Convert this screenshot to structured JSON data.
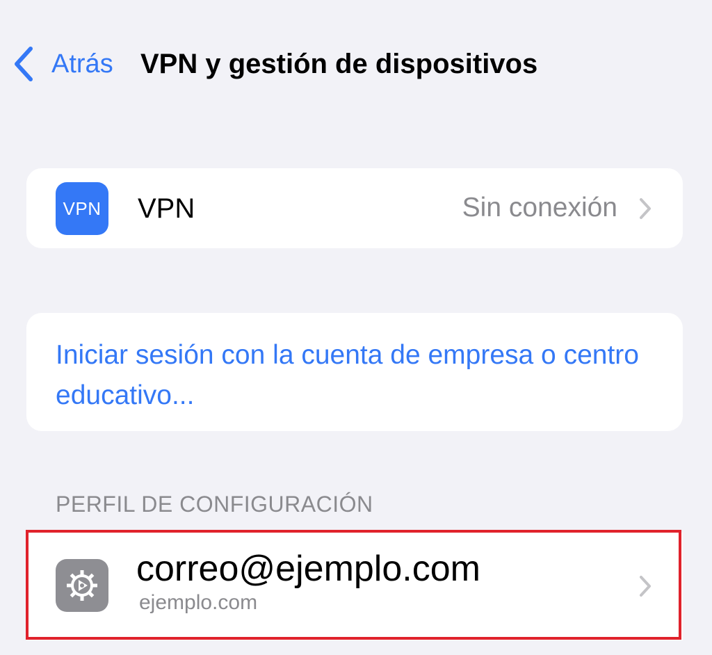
{
  "nav": {
    "back_label": "Atrás",
    "title": "VPN y gestión de dispositivos"
  },
  "vpn_row": {
    "icon_text": "VPN",
    "label": "VPN",
    "status": "Sin conexión"
  },
  "signin": {
    "label": "Iniciar sesión con la cuenta de empresa o centro educativo..."
  },
  "profile_section": {
    "header": "PERFIL DE CONFIGURACIÓN",
    "email": "correo@ejemplo.com",
    "domain": "ejemplo.com"
  },
  "colors": {
    "background": "#f2f2f7",
    "accent": "#3478f6",
    "secondary_text": "#8a8a8e",
    "highlight": "#e0222c",
    "profile_icon_bg": "#8e8e93"
  },
  "icons": {
    "back": "chevron-left-icon",
    "disclosure": "chevron-right-icon",
    "vpn": "vpn-icon",
    "profile": "settings-gear-icon"
  }
}
